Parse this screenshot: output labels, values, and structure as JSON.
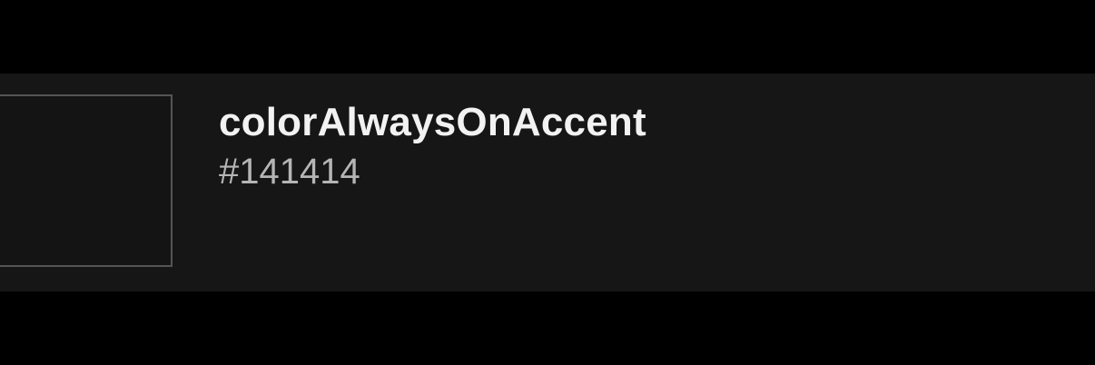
{
  "color_token": {
    "name": "colorAlwaysOnAccent",
    "hex_label": "#141414",
    "swatch_color": "#141414",
    "swatch_border_color": "#555555"
  },
  "theme": {
    "page_background": "#000000",
    "row_background": "#161616",
    "name_text_color": "#f2f2f2",
    "hex_text_color": "#b5b5b5"
  }
}
